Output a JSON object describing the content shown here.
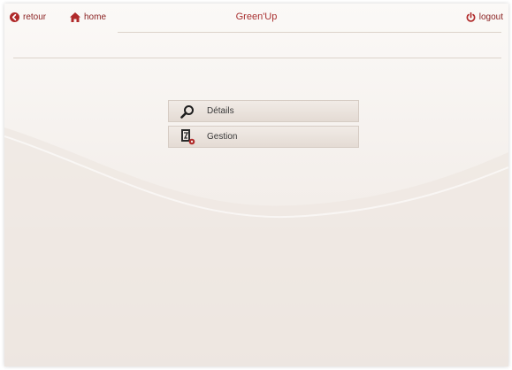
{
  "header": {
    "back_label": "retour",
    "home_label": "home",
    "title": "Green'Up",
    "logout_label": "logout"
  },
  "menu": {
    "items": [
      {
        "label": "Détails",
        "icon": "search-icon"
      },
      {
        "label": "Gestion",
        "icon": "manage-document-icon"
      }
    ]
  },
  "colors": {
    "accent": "#8b2323",
    "title": "#a83030",
    "background": "#f3eeea"
  }
}
